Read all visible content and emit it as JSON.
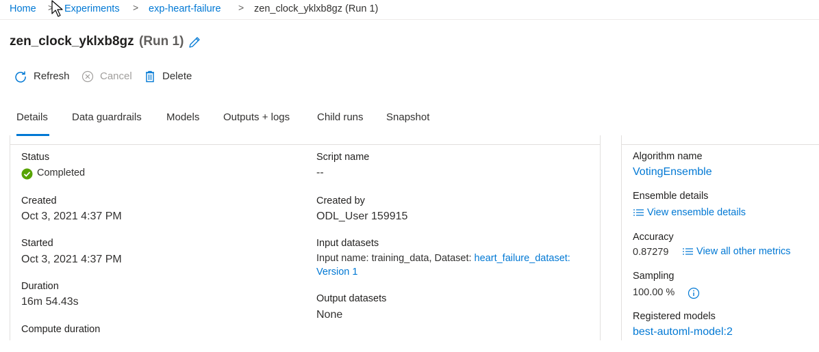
{
  "breadcrumb": {
    "home": "Home",
    "experiments": "Experiments",
    "experiment": "exp-heart-failure",
    "current": "zen_clock_yklxb8gz (Run 1)",
    "separator": ">"
  },
  "header": {
    "title": "zen_clock_yklxb8gz",
    "run_label": "(Run 1)"
  },
  "toolbar": {
    "refresh": "Refresh",
    "cancel": "Cancel",
    "delete": "Delete"
  },
  "tabs": [
    "Details",
    "Data guardrails",
    "Models",
    "Outputs + logs",
    "Child runs",
    "Snapshot"
  ],
  "details": {
    "status_label": "Status",
    "status_value": "Completed",
    "created_label": "Created",
    "created_value": "Oct 3, 2021 4:37 PM",
    "started_label": "Started",
    "started_value": "Oct 3, 2021 4:37 PM",
    "duration_label": "Duration",
    "duration_value": "16m 54.43s",
    "compute_duration_label": "Compute duration",
    "script_name_label": "Script name",
    "script_name_value": "--",
    "created_by_label": "Created by",
    "created_by_value": "ODL_User 159915",
    "input_datasets_label": "Input datasets",
    "input_datasets_prefix": "Input name: training_data, Dataset:",
    "input_dataset_link": "heart_failure_dataset:",
    "input_dataset_version": "Version 1",
    "output_datasets_label": "Output datasets",
    "output_datasets_value": "None"
  },
  "summary": {
    "algorithm_label": "Algorithm name",
    "algorithm_value": "VotingEnsemble",
    "ensemble_label": "Ensemble details",
    "ensemble_link": "View ensemble details",
    "accuracy_label": "Accuracy",
    "accuracy_value": "0.87279",
    "metrics_link": "View all other metrics",
    "sampling_label": "Sampling",
    "sampling_value": "100.00 %",
    "registered_label": "Registered models",
    "registered_value": "best-automl-model:2"
  },
  "colors": {
    "accent": "#0078d4",
    "success": "#57a300",
    "text": "#323130"
  },
  "icons": [
    "refresh-icon",
    "cancel-icon",
    "delete-icon",
    "edit-icon",
    "success-icon",
    "list-icon",
    "info-icon",
    "mouse-cursor-icon"
  ]
}
